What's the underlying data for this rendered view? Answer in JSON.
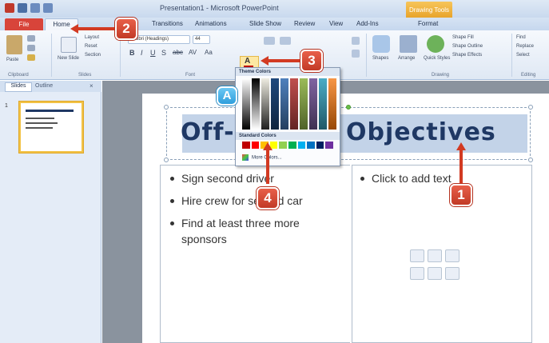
{
  "window": {
    "title": "Presentation1 - Microsoft PowerPoint",
    "context_tab_header": "Drawing Tools"
  },
  "ribbon_tabs": [
    {
      "label": "File"
    },
    {
      "label": "Home"
    },
    {
      "label": "Transitions"
    },
    {
      "label": "Animations"
    },
    {
      "label": "Slide Show"
    },
    {
      "label": "Review"
    },
    {
      "label": "View"
    },
    {
      "label": "Add-Ins"
    },
    {
      "label": "Format"
    }
  ],
  "ribbon": {
    "clipboard": {
      "paste": "Paste",
      "label": "Clipboard"
    },
    "slides": {
      "new_slide": "New Slide",
      "layout": "Layout",
      "reset": "Reset",
      "section": "Section",
      "label": "Slides"
    },
    "font": {
      "name": "Calibri (Headings)",
      "size": "44",
      "label": "Font"
    },
    "drawing": {
      "shapes": "Shapes",
      "arrange": "Arrange",
      "quick_styles": "Quick Styles",
      "shape_fill": "Shape Fill",
      "shape_outline": "Shape Outline",
      "shape_effects": "Shape Effects",
      "label": "Drawing"
    },
    "editing": {
      "find": "Find",
      "replace": "Replace",
      "select": "Select",
      "label": "Editing"
    }
  },
  "left_pane": {
    "tab_slides": "Slides",
    "tab_outline": "Outline",
    "close": "×",
    "slide_number": "1"
  },
  "slide": {
    "title": "Off-Season Objectives",
    "bullets": [
      "Sign second driver",
      "Hire crew for second car",
      "Find at least three more",
      "sponsors"
    ],
    "right_placeholder": "Click to add text"
  },
  "color_menu": {
    "theme_header": "Theme Colors",
    "standard_header": "Standard Colors",
    "more_colors": "More Colors...",
    "theme_columns": [
      [
        "#ffffff",
        "#000000"
      ],
      [
        "#000000",
        "#ffffff"
      ],
      [
        "#eeece1",
        "#1f1f1f"
      ],
      [
        "#1f497d",
        "#0f243e"
      ],
      [
        "#4f81bd",
        "#243f60"
      ],
      [
        "#c0504d",
        "#632423"
      ],
      [
        "#9bbb59",
        "#4f6228"
      ],
      [
        "#8064a2",
        "#3f3151"
      ],
      [
        "#4bacc6",
        "#205867"
      ],
      [
        "#f79646",
        "#974806"
      ]
    ],
    "standard_colors": [
      "#c00000",
      "#ff0000",
      "#ffc000",
      "#ffff00",
      "#92d050",
      "#00b050",
      "#00b0f0",
      "#0070c0",
      "#002060",
      "#7030a0"
    ]
  },
  "callouts": {
    "step1": "1",
    "step2": "2",
    "step3": "3",
    "step4": "4",
    "stepA": "A"
  },
  "colors": {
    "callout_red": "#d23a22",
    "callout_blue": "#2f9fdc",
    "title_text": "#1f3864"
  }
}
